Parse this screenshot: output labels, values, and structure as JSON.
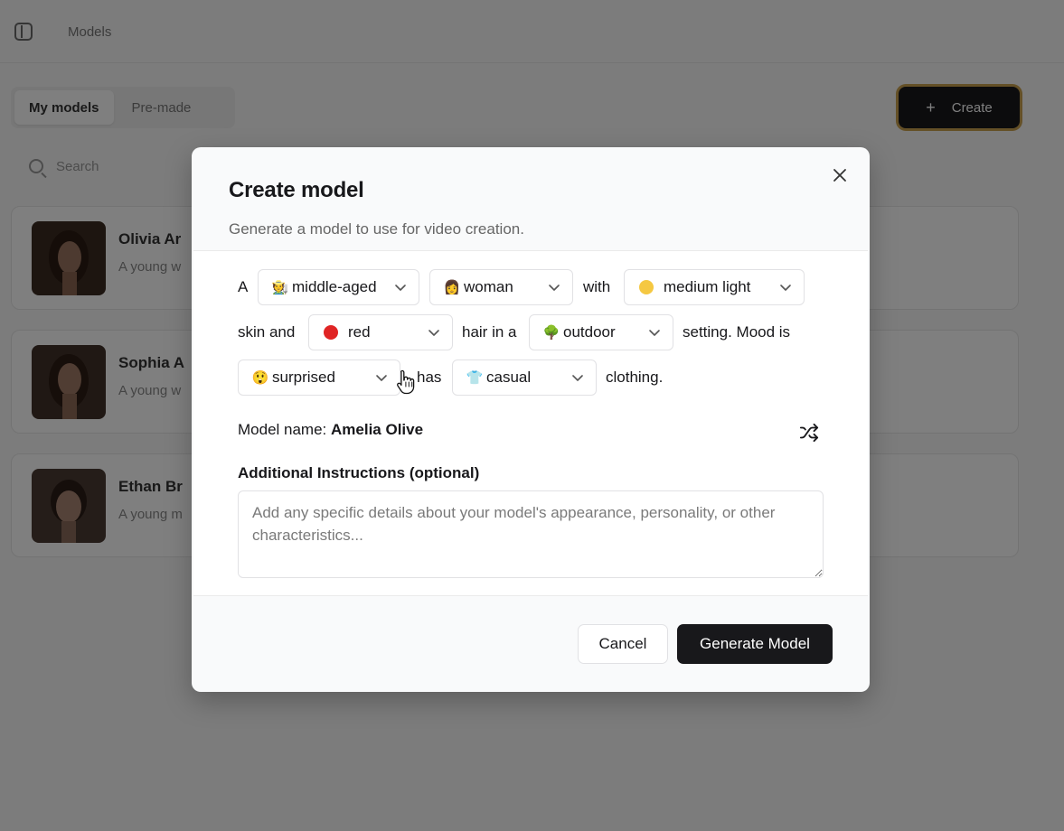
{
  "background": {
    "topbar_title": "Models",
    "tabs": [
      {
        "label": "My models",
        "active": true
      },
      {
        "label": "Pre-made",
        "active": false
      }
    ],
    "create_button": {
      "label": "Create",
      "icon": "plus-icon"
    },
    "search": {
      "placeholder": "Search"
    },
    "models": [
      {
        "name": "Olivia Ar",
        "desc": "A young w"
      },
      {
        "name": "Sophia A",
        "desc": "A young w"
      },
      {
        "name": "Ethan Br",
        "desc": "A young m"
      }
    ]
  },
  "modal": {
    "title": "Create model",
    "description": "Generate a model to use for video creation.",
    "close_icon": "close-icon",
    "sentence": {
      "w_a": "A",
      "w_with": "with",
      "w_skin_and": "skin and",
      "w_hair_in_a": "hair in a",
      "w_setting_mood": "setting. Mood is",
      "w_has": "has",
      "w_clothing": "clothing."
    },
    "selects": {
      "age": {
        "value": "middle-aged",
        "icon": "🧑‍🌾"
      },
      "gender": {
        "value": "woman",
        "icon": "👩"
      },
      "skin": {
        "value": "medium light",
        "color": "#f5c842"
      },
      "hair": {
        "value": "red",
        "color": "#e02424"
      },
      "setting": {
        "value": "outdoor",
        "icon": "🌳"
      },
      "mood": {
        "value": "surprised",
        "icon": "😲"
      },
      "clothing": {
        "value": "casual",
        "icon": "👕"
      }
    },
    "model_name_label": "Model name:",
    "model_name_value": "Amelia Olive",
    "shuffle_icon": "shuffle-icon",
    "instructions_label": "Additional Instructions (optional)",
    "instructions_placeholder": "Add any specific details about your model's appearance, personality, or other characteristics...",
    "instructions_value": "",
    "cancel_label": "Cancel",
    "generate_label": "Generate Model"
  }
}
